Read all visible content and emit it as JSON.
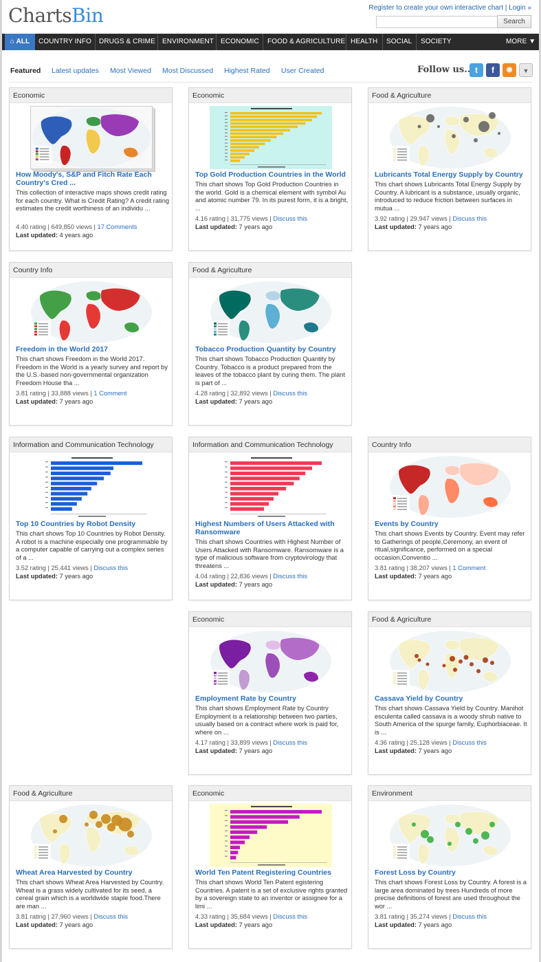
{
  "logo": {
    "part1": "Charts",
    "part2": "Bin"
  },
  "top_links": {
    "register": "Register to create your own interactive chart",
    "sep": " | ",
    "login": "Login »"
  },
  "search": {
    "button": "Search",
    "placeholder": ""
  },
  "nav": {
    "all": "ALL",
    "items": [
      "COUNTRY INFO",
      "DRUGS & CRIME",
      "ENVIRONMENT",
      "ECONOMIC",
      "FOOD & AGRICULTURE",
      "HEALTH",
      "SOCIAL",
      "SOCIETY"
    ],
    "more": "MORE ▼"
  },
  "tabs": [
    "Featured",
    "Latest updates",
    "Most Viewed",
    "Most Discussed",
    "Highest Rated",
    "User Created"
  ],
  "follow": "Follow us...",
  "cards": [
    {
      "category": "Economic",
      "title": "How Moody's, S&P and Fitch Rate Each Country's Cred ...",
      "desc": "This collection of interactive maps shows credit rating for each country. What is Credit Rating? A credit rating estimates the credit worthiness of an individu ...",
      "stats": "4.40 rating | 649,850 views | ",
      "link": "17 Comments",
      "updated": "4 years ago",
      "thumb": "map-multi"
    },
    {
      "category": "Economic",
      "title": "Top Gold Production Countries in the World",
      "desc": "This chart shows Top Gold Production Countries in the world. Gold is a chemical element with symbol Au and atomic number 79. In its purest form, it is a bright, ...",
      "stats": "4.16 rating | 31,775 views | ",
      "link": "Discuss this",
      "updated": "7 years ago",
      "thumb": "bar-gold"
    },
    {
      "category": "Food & Agriculture",
      "title": "Lubricants Total Energy Supply by Country",
      "desc": "This chart shows Lubricants Total Energy Supply by Country. A lubricant is a substance, usually organic, introduced to reduce friction between surfaces in mutua ...",
      "stats": "3.92 rating | 29,947 views | ",
      "link": "Discuss this",
      "updated": "7 years ago",
      "thumb": "bubble-gray"
    },
    {
      "category": "Country Info",
      "title": "Freedom in the World 2017",
      "desc": "This chart shows Freedom in the World 2017. Freedom in the World is a yearly survey and report by the U.S.-based non-governmental organization Freedom House tha ...",
      "stats": "3.81 rating | 33,888 views | ",
      "link": "1 Comment",
      "updated": "7 years ago",
      "thumb": "map-freedom"
    },
    {
      "category": "Food & Agriculture",
      "title": "Tobacco Production Quantity by Country",
      "desc": "This chart shows Tobacco Production Quantity by Country. Tobacco is a product prepared from the leaves of the tobacco plant by curing them. The plant is part of ...",
      "stats": "4.28 rating | 32,892 views | ",
      "link": "Discuss this",
      "updated": "7 years ago",
      "thumb": "map-teal"
    },
    {
      "category": "Information and Communication Technology",
      "title": "Top 10 Countries by Robot Density",
      "desc": "This chart shows Top 10 Countries by Robot Density. A robot is a machine especially one programmable by a computer capable of carrying out a complex series of a ...",
      "stats": "3.52 rating | 25,441 views | ",
      "link": "Discuss this",
      "updated": "7 years ago",
      "thumb": "bar-blue"
    },
    {
      "category": "Information and Communication Technology",
      "title": "Highest Numbers of Users Attacked with Ransomware",
      "desc": "This chart shows Countries with Highest Number of Users Attacked with Ransomware. Ransomware is a type of malicious software from cryptovirology that threatens ...",
      "stats": "4.04 rating | 22,836 views | ",
      "link": "Discuss this",
      "updated": "7 years ago",
      "thumb": "bar-red"
    },
    {
      "category": "Country Info",
      "title": "Events by Country",
      "desc": "This chart shows Events by Country. Event may refer to Gatherings of people,Ceremony, an event of ritual,significance, performed on a special occasion,Conventio ...",
      "stats": "3.81 rating | 38,207 views | ",
      "link": "1 Comment",
      "updated": "7 years ago",
      "thumb": "map-red"
    },
    {
      "category": "Economic",
      "title": "Employment Rate by Country",
      "desc": "This chart shows  Employment Rate by Country Employment is a relationship between two parties, usually based on a contract where work is paid for, where on ...",
      "stats": "4.17 rating | 33,899 views | ",
      "link": "Discuss this",
      "updated": "7 years ago",
      "thumb": "map-purple"
    },
    {
      "category": "Food & Agriculture",
      "title": "Cassava Yield by Country",
      "desc": "This chart shows Cassava Yield by Country. Manihot esculenta called cassava is a woody shrub native to South America of the spurge family, Euphorbiaceae. It is ...",
      "stats": "4.36 rating | 25,128 views | ",
      "link": "Discuss this",
      "updated": "7 years ago",
      "thumb": "bubble-brown"
    },
    {
      "category": "Food & Agriculture",
      "title": "Wheat Area Harvested by Country",
      "desc": "This chart shows Wheat Area Harvested by Country. Wheat is a grass widely cultivated for its seed, a cereal grain which is a worldwide staple food.There are man ...",
      "stats": "3.81 rating | 27,960 views | ",
      "link": "Discuss this",
      "updated": "7 years ago",
      "thumb": "bubble-gold"
    },
    {
      "category": "Economic",
      "title": "World Ten Patent Registering Countries",
      "desc": "This chart shows World Ten Patent egistering Countries. A patent is a set of exclusive rights granted by a sovereign state to an inventor or assignee for a limi ...",
      "stats": "4.33 rating | 35,684 views | ",
      "link": "Discuss this",
      "updated": "7 years ago",
      "thumb": "bar-magenta"
    },
    {
      "category": "Environment",
      "title": "Forest Loss by Country",
      "desc": "This chart shows Forest Loss by Country. A forest is a large area dominated by trees Hundreds of more precise definitions of forest are used throughout the wor ...",
      "stats": "3.81 rating | 35,274 views | ",
      "link": "Discuss this",
      "updated": "7 years ago",
      "thumb": "bubble-green"
    }
  ],
  "updated_label": "Last updated:"
}
